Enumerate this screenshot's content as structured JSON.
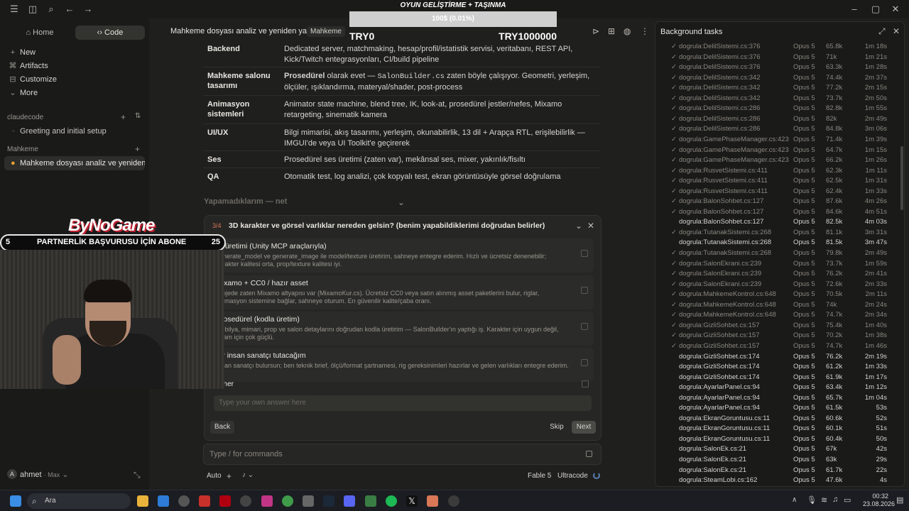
{
  "sidebar": {
    "tabs": {
      "home": "Home",
      "code": "Code"
    },
    "nav": [
      {
        "label": "New",
        "icon": "plus-icon"
      },
      {
        "label": "Artifacts",
        "icon": "artifacts-icon"
      },
      {
        "label": "Customize",
        "icon": "customize-icon"
      },
      {
        "label": "More",
        "icon": "chevron-down-icon"
      }
    ],
    "section1": "claudecode",
    "chat1": "Greeting and initial setup",
    "section2": "Mahkeme",
    "chat2": "Mahkeme dosyası analiz ve yeniden yazım",
    "user": {
      "name": "ahmet",
      "plan": "Max",
      "initial": "A"
    }
  },
  "header": {
    "title": "Mahkeme dosyası analiz ve yeniden yazım",
    "badge": "Mahkeme"
  },
  "stream": {
    "title": "OYUN GELİŞTİRME + TAŞINMA",
    "progress_text": "100$ (0.01%)",
    "left": "TRY0",
    "right": "TRY1000000",
    "logo": "ByNoGame",
    "banner": "PARTNERLİK BAŞVURUSU İÇİN ABONE",
    "banner_left": "5",
    "banner_right": "25"
  },
  "table": [
    {
      "k": "Backend",
      "v": "Dedicated server, matchmaking, hesap/profil/istatistik servisi, veritabanı, REST API, Kick/Twitch entegrasyonları, CI/build pipeline"
    },
    {
      "k": "Mahkeme salonu tasarımı",
      "v1": "Prosedürel",
      "v2": " olarak evet — ",
      "code": "SalonBuilder.cs",
      "v3": " zaten böyle çalışıyor. Geometri, yerleşim, ölçüler, ışıklandırma, materyal/shader, post-process"
    },
    {
      "k": "Animasyon sistemleri",
      "v": "Animator state machine, blend tree, IK, look-at, prosedürel jestler/nefes, Mixamo retargeting, sinematik kamera"
    },
    {
      "k": "UI/UX",
      "v": "Bilgi mimarisi, akış tasarımı, yerleşim, okunabilirlik, 13 dil + Arapça RTL, erişilebilirlik — IMGUI'de veya UI Toolkit'e geçirerek"
    },
    {
      "k": "Ses",
      "v": "Prosedürel ses üretimi (zaten var), mekânsal ses, mixer, yakınlık/fisıltı"
    },
    {
      "k": "QA",
      "v": "Otomatik test, log analizi, çok kopyalı test, ekran görüntüsüyle görsel doğrulama"
    }
  ],
  "section_head": "Yapamadıklarım — net",
  "question": {
    "counter": "3/4",
    "title": "3D karakter ve görsel varlıklar nereden gelsin? (benim yapabildiklerimi doğrudan belirler)",
    "options": [
      {
        "t": "AI üretimi (Unity MCP araçlarıyla)",
        "d": "generate_model ve generate_image ile model/texture üretirim, sahneye entegre ederim. Hızlı ve ücretsiz denenebilir; karakter kalitesi orta, prop/texture kalitesi iyi."
      },
      {
        "t": "Mixamo + CC0 / hazır asset",
        "d": "Projede zaten Mixamo altyapısı var (MixamoKur.cs). Ücretsiz CC0 veya satın alınmış asset paketlerini bulur, riglar, animasyon sistemine bağlar, sahneye oturum. En güvenilir kalite/çaba oranı."
      },
      {
        "t": "Prosedürel (kodla üretim)",
        "d": "Mobilya, mimari, prop ve salon detaylarını doğrudan kodla üretirim — SalonBuilder'ın yaptığı iş. Karakter için uygun değil, ortam için çok güçlü."
      },
      {
        "t": "Bir insan sanatçı tutacağım",
        "d": "İnsan sanatçı bulursun; ben teknik brief, ölçü/format şartnamesi, rig gereksinimleri hazırlar ve gelen varlıkları entegre ederim."
      }
    ],
    "other_label": "Other",
    "answer_placeholder": "Type your own answer here",
    "back": "Back",
    "skip": "Skip",
    "next": "Next"
  },
  "composer": {
    "placeholder": "Type / for commands",
    "auto": "Auto",
    "model": "Fable 5",
    "effort": "Ultracode"
  },
  "panel": {
    "title": "Background tasks"
  },
  "tasks": [
    {
      "n": "dogrula:DelilSistemi.cs:376",
      "m": "Opus 5",
      "k": "65.8k",
      "t": "1m 18s",
      "done": true
    },
    {
      "n": "dogrula:DelilSistemi.cs:376",
      "m": "Opus 5",
      "k": "71k",
      "t": "1m 21s",
      "done": true
    },
    {
      "n": "dogrula:DelilSistemi.cs:376",
      "m": "Opus 5",
      "k": "63.3k",
      "t": "1m 28s",
      "done": true
    },
    {
      "n": "dogrula:DelilSistemi.cs:342",
      "m": "Opus 5",
      "k": "74.4k",
      "t": "2m 37s",
      "done": true
    },
    {
      "n": "dogrula:DelilSistemi.cs:342",
      "m": "Opus 5",
      "k": "77.2k",
      "t": "2m 15s",
      "done": true
    },
    {
      "n": "dogrula:DelilSistemi.cs:342",
      "m": "Opus 5",
      "k": "73.7k",
      "t": "2m 50s",
      "done": true
    },
    {
      "n": "dogrula:DelilSistemi.cs:286",
      "m": "Opus 5",
      "k": "82.8k",
      "t": "1m 55s",
      "done": true
    },
    {
      "n": "dogrula:DelilSistemi.cs:286",
      "m": "Opus 5",
      "k": "82k",
      "t": "2m 49s",
      "done": true
    },
    {
      "n": "dogrula:DelilSistemi.cs:286",
      "m": "Opus 5",
      "k": "84.8k",
      "t": "3m 06s",
      "done": true
    },
    {
      "n": "dogrula:GamePhaseManager.cs:423",
      "m": "Opus 5",
      "k": "71.4k",
      "t": "1m 39s",
      "done": true
    },
    {
      "n": "dogrula:GamePhaseManager.cs:423",
      "m": "Opus 5",
      "k": "64.7k",
      "t": "1m 15s",
      "done": true
    },
    {
      "n": "dogrula:GamePhaseManager.cs:423",
      "m": "Opus 5",
      "k": "66.2k",
      "t": "1m 26s",
      "done": true
    },
    {
      "n": "dogrula:RusvetSistemi.cs:411",
      "m": "Opus 5",
      "k": "62.3k",
      "t": "1m 11s",
      "done": true
    },
    {
      "n": "dogrula:RusvetSistemi.cs:411",
      "m": "Opus 5",
      "k": "62.5k",
      "t": "1m 31s",
      "done": true
    },
    {
      "n": "dogrula:RusvetSistemi.cs:411",
      "m": "Opus 5",
      "k": "62.4k",
      "t": "1m 33s",
      "done": true
    },
    {
      "n": "dogrula:BalonSohbet.cs:127",
      "m": "Opus 5",
      "k": "87.6k",
      "t": "4m 26s",
      "done": true
    },
    {
      "n": "dogrula:BalonSohbet.cs:127",
      "m": "Opus 5",
      "k": "84.6k",
      "t": "4m 51s",
      "done": true
    },
    {
      "n": "dogrula:BalonSohbet.cs:127",
      "m": "Opus 5",
      "k": "82.5k",
      "t": "4m 03s",
      "done": false
    },
    {
      "n": "dogrula:TutanakSistemi.cs:268",
      "m": "Opus 5",
      "k": "81.1k",
      "t": "3m 31s",
      "done": true
    },
    {
      "n": "dogrula:TutanakSistemi.cs:268",
      "m": "Opus 5",
      "k": "81.5k",
      "t": "3m 47s",
      "done": false
    },
    {
      "n": "dogrula:TutanakSistemi.cs:268",
      "m": "Opus 5",
      "k": "79.8k",
      "t": "2m 49s",
      "done": true
    },
    {
      "n": "dogrula:SalonEkrani.cs:239",
      "m": "Opus 5",
      "k": "73.7k",
      "t": "1m 59s",
      "done": true
    },
    {
      "n": "dogrula:SalonEkrani.cs:239",
      "m": "Opus 5",
      "k": "76.2k",
      "t": "2m 41s",
      "done": true
    },
    {
      "n": "dogrula:SalonEkrani.cs:239",
      "m": "Opus 5",
      "k": "72.6k",
      "t": "2m 33s",
      "done": true
    },
    {
      "n": "dogrula:MahkemeKontrol.cs:648",
      "m": "Opus 5",
      "k": "70.5k",
      "t": "2m 11s",
      "done": true
    },
    {
      "n": "dogrula:MahkemeKontrol.cs:648",
      "m": "Opus 5",
      "k": "74k",
      "t": "2m 24s",
      "done": true
    },
    {
      "n": "dogrula:MahkemeKontrol.cs:648",
      "m": "Opus 5",
      "k": "74.7k",
      "t": "2m 34s",
      "done": true
    },
    {
      "n": "dogrula:GizliSohbet.cs:157",
      "m": "Opus 5",
      "k": "75.4k",
      "t": "1m 40s",
      "done": true
    },
    {
      "n": "dogrula:GizliSohbet.cs:157",
      "m": "Opus 5",
      "k": "70.2k",
      "t": "1m 38s",
      "done": true
    },
    {
      "n": "dogrula:GizliSohbet.cs:157",
      "m": "Opus 5",
      "k": "74.7k",
      "t": "1m 46s",
      "done": true
    },
    {
      "n": "dogrula:GizliSohbet.cs:174",
      "m": "Opus 5",
      "k": "76.2k",
      "t": "2m 19s",
      "done": false
    },
    {
      "n": "dogrula:GizliSohbet.cs:174",
      "m": "Opus 5",
      "k": "61.2k",
      "t": "1m 33s",
      "done": false
    },
    {
      "n": "dogrula:GizliSohbet.cs:174",
      "m": "Opus 5",
      "k": "61.9k",
      "t": "1m 17s",
      "done": false
    },
    {
      "n": "dogrula:AyarlarPanel.cs:94",
      "m": "Opus 5",
      "k": "63.4k",
      "t": "1m 12s",
      "done": false
    },
    {
      "n": "dogrula:AyarlarPanel.cs:94",
      "m": "Opus 5",
      "k": "65.7k",
      "t": "1m 04s",
      "done": false
    },
    {
      "n": "dogrula:AyarlarPanel.cs:94",
      "m": "Opus 5",
      "k": "61.5k",
      "t": "53s",
      "done": false
    },
    {
      "n": "dogrula:EkranGoruntusu.cs:11",
      "m": "Opus 5",
      "k": "60.6k",
      "t": "52s",
      "done": false
    },
    {
      "n": "dogrula:EkranGoruntusu.cs:11",
      "m": "Opus 5",
      "k": "60.1k",
      "t": "51s",
      "done": false
    },
    {
      "n": "dogrula:EkranGoruntusu.cs:11",
      "m": "Opus 5",
      "k": "60.4k",
      "t": "50s",
      "done": false
    },
    {
      "n": "dogrula:SalonEk.cs:21",
      "m": "Opus 5",
      "k": "67k",
      "t": "42s",
      "done": false
    },
    {
      "n": "dogrula:SalonEk.cs:21",
      "m": "Opus 5",
      "k": "63k",
      "t": "29s",
      "done": false
    },
    {
      "n": "dogrula:SalonEk.cs:21",
      "m": "Opus 5",
      "k": "61.7k",
      "t": "22s",
      "done": false
    },
    {
      "n": "dogrula:SteamLobi.cs:162",
      "m": "Opus 5",
      "k": "47.6k",
      "t": "4s",
      "done": false
    }
  ],
  "taskbar": {
    "search": "Ara",
    "time": "00:32",
    "date": "23.08.2026"
  }
}
